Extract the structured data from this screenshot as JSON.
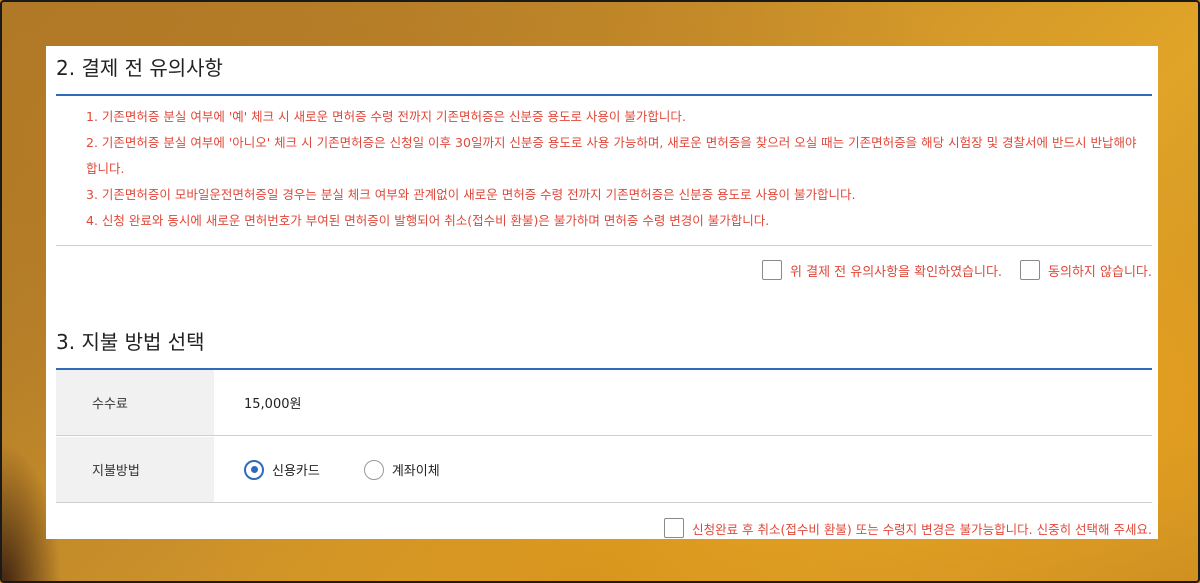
{
  "section2": {
    "title": "2. 결제 전 유의사항",
    "notices": [
      "1. 기존면허증 분실 여부에 '예' 체크 시 새로운 면허증 수령 전까지 기존면허증은 신분증 용도로 사용이 불가합니다.",
      "2. 기존면허증 분실 여부에 '아니오' 체크 시 기존면허증은 신청일 이후 30일까지 신분증 용도로 사용 가능하며, 새로운 면허증을 찾으러 오실 때는 기존면허증을 해당 시험장 및 경찰서에 반드시 반납해야 합니다.",
      "3. 기존면허증이 모바일운전면허증일 경우는 분실 체크 여부와 관계없이 새로운 면허증 수령 전까지 기존면허증은 신분증 용도로 사용이 불가합니다.",
      "4. 신청 완료와 동시에 새로운 면허번호가 부여된 면허증이 발행되어 취소(접수비 환불)은 불가하며 면허증 수령 변경이 불가합니다."
    ],
    "agree_label": "위 결제 전 유의사항을 확인하였습니다.",
    "disagree_label": "동의하지 않습니다."
  },
  "section3": {
    "title": "3. 지불 방법 선택",
    "fee_label": "수수료",
    "fee_value": "15,000원",
    "method_label": "지불방법",
    "methods": [
      {
        "label": "신용카드",
        "selected": true
      },
      {
        "label": "계좌이체",
        "selected": false
      }
    ],
    "final_notice": "신청완료 후 취소(접수비 환불) 또는 수령지 변경은 불가능합니다. 신중히 선택해 주세요."
  },
  "colors": {
    "accent": "#2e6bb8",
    "warning_text": "#e0483a"
  }
}
